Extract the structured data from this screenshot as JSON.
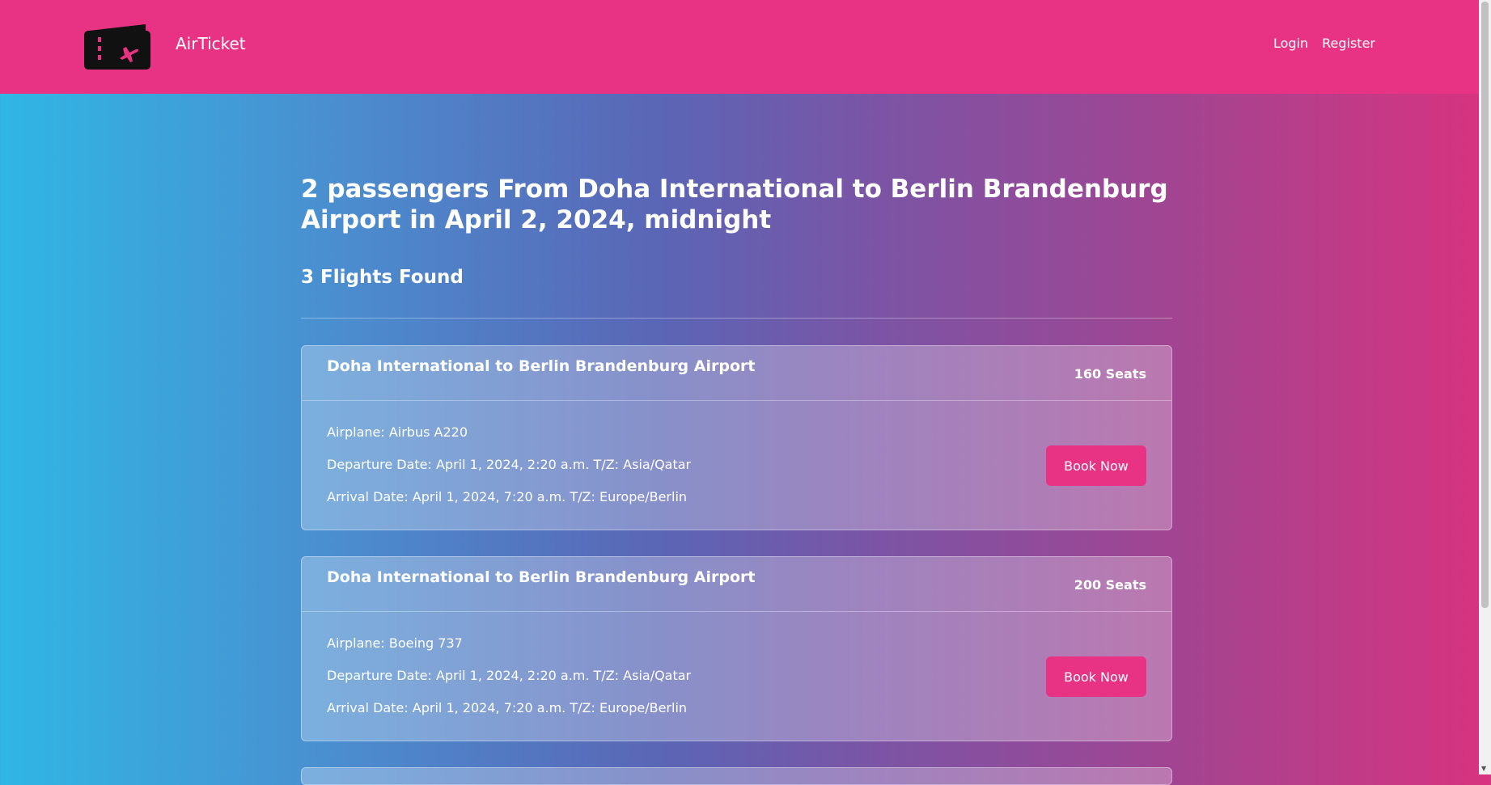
{
  "navbar": {
    "brand": "AirTicket",
    "links": [
      "Login",
      "Register"
    ]
  },
  "search": {
    "title": "2 passengers From Doha International to Berlin Brandenburg Airport in April 2, 2024, midnight",
    "result_count": "3 Flights Found"
  },
  "flights": [
    {
      "route": "Doha International to Berlin Brandenburg Airport",
      "seats": "160 Seats",
      "airplane": "Airplane: Airbus A220",
      "departure": "Departure Date: April 1, 2024, 2:20 a.m. T/Z: Asia/Qatar",
      "arrival": "Arrival Date: April 1, 2024, 7:20 a.m. T/Z: Europe/Berlin",
      "button": "Book Now"
    },
    {
      "route": "Doha International to Berlin Brandenburg Airport",
      "seats": "200 Seats",
      "airplane": "Airplane: Boeing 737",
      "departure": "Departure Date: April 1, 2024, 2:20 a.m. T/Z: Asia/Qatar",
      "arrival": "Arrival Date: April 1, 2024, 7:20 a.m. T/Z: Europe/Berlin",
      "button": "Book Now"
    }
  ],
  "colors": {
    "accent": "#e83283",
    "gradient_start": "#2fb6e4",
    "gradient_end": "#d8337f"
  }
}
